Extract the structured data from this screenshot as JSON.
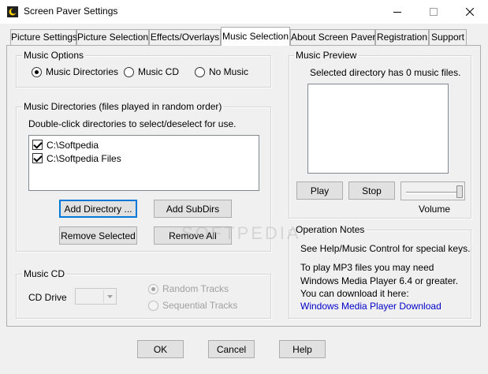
{
  "window": {
    "title": "Screen Paver Settings",
    "minimize_glyph": "—",
    "maximize_glyph": "☐",
    "close_glyph": "✕"
  },
  "tabs": [
    {
      "label": "Picture Settings"
    },
    {
      "label": "Picture Selection"
    },
    {
      "label": "Effects/Overlays"
    },
    {
      "label": "Music Selection",
      "active": true
    },
    {
      "label": "About Screen Paver"
    },
    {
      "label": "Registration"
    },
    {
      "label": "Support"
    }
  ],
  "music_options": {
    "label": "Music Options",
    "options": [
      "Music Directories",
      "Music CD",
      "No Music"
    ],
    "selected": "Music Directories"
  },
  "music_directories": {
    "label": "Music Directories (files played in random order)",
    "hint": "Double-click directories to select/deselect for use.",
    "items": [
      {
        "path": "C:\\Softpedia",
        "checked": true
      },
      {
        "path": "C:\\Softpedia Files",
        "checked": true
      }
    ],
    "add_directory_label": "Add Directory ...",
    "add_subdirs_label": "Add SubDirs",
    "remove_selected_label": "Remove Selected",
    "remove_all_label": "Remove All"
  },
  "music_cd": {
    "label": "Music CD",
    "drive_label": "CD Drive",
    "drive_value": "",
    "random_label": "Random Tracks",
    "sequential_label": "Sequential Tracks",
    "selected": "Random Tracks"
  },
  "music_preview": {
    "label": "Music Preview",
    "status": "Selected directory has 0 music files.",
    "play_label": "Play",
    "stop_label": "Stop",
    "volume_label": "Volume",
    "volume_level": 1.0
  },
  "operation_notes": {
    "label": "Operation Notes",
    "line1": "See Help/Music Control for special keys.",
    "line2": "To play MP3 files you may need",
    "line3": "Windows Media Player 6.4 or greater.",
    "line4": "You can download it here:",
    "link": "Windows Media Player Download"
  },
  "footer": {
    "ok_label": "OK",
    "cancel_label": "Cancel",
    "help_label": "Help"
  },
  "watermark": "SOFTPEDIA"
}
